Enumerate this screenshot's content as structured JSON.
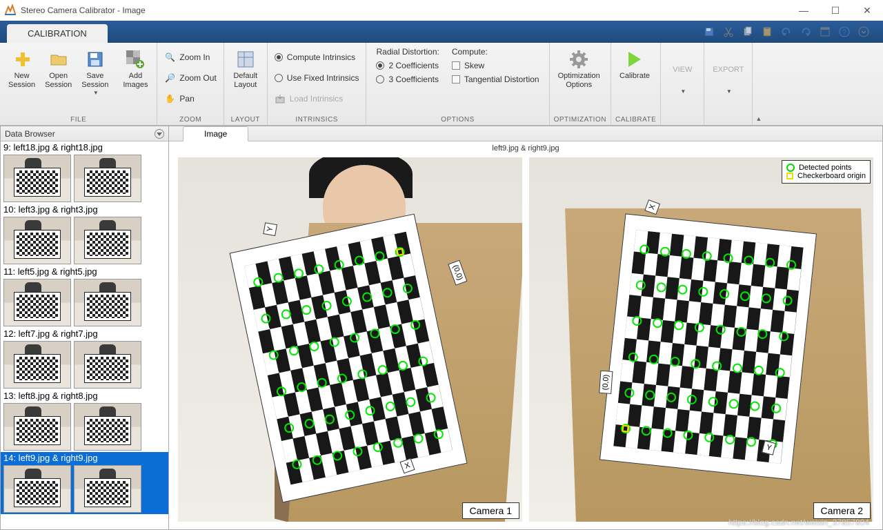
{
  "window": {
    "title": "Stereo Camera Calibrator - Image"
  },
  "main_tab": "CALIBRATION",
  "ribbon": {
    "file": {
      "new_session": "New\nSession",
      "open_session": "Open\nSession",
      "save_session": "Save\nSession",
      "add_images": "Add\nImages",
      "label": "FILE"
    },
    "zoom": {
      "in": "Zoom In",
      "out": "Zoom Out",
      "pan": "Pan",
      "label": "ZOOM"
    },
    "layout": {
      "default": "Default\nLayout",
      "label": "LAYOUT"
    },
    "intrinsics": {
      "compute": "Compute Intrinsics",
      "fixed": "Use Fixed Intrinsics",
      "load": "Load Intrinsics",
      "label": "INTRINSICS"
    },
    "options": {
      "radial_label": "Radial Distortion:",
      "r2": "2 Coefficients",
      "r3": "3 Coefficients",
      "compute_label": "Compute:",
      "skew": "Skew",
      "tangential": "Tangential Distortion",
      "label": "OPTIONS"
    },
    "optimization": {
      "btn": "Optimization\nOptions",
      "label": "OPTIMIZATION"
    },
    "calibrate": {
      "btn": "Calibrate",
      "label": "CALIBRATE"
    },
    "view": "VIEW",
    "export": "EXPORT"
  },
  "browser": {
    "title": "Data Browser",
    "items": [
      {
        "label": "9: left18.jpg & right18.jpg"
      },
      {
        "label": "10: left3.jpg & right3.jpg"
      },
      {
        "label": "11: left5.jpg & right5.jpg"
      },
      {
        "label": "12: left7.jpg & right7.jpg"
      },
      {
        "label": "13: left8.jpg & right8.jpg"
      },
      {
        "label": "14: left9.jpg & right9.jpg"
      }
    ],
    "selected_index": 5
  },
  "viewer": {
    "tab": "Image",
    "pair_title": "left9.jpg & right9.jpg",
    "cam1_label": "Camera 1",
    "cam2_label": "Camera 2",
    "origin_label": "(0,0)",
    "axis_x": "X",
    "axis_y": "Y",
    "legend": {
      "detected": "Detected points",
      "origin": "Checkerboard origin"
    }
  },
  "watermark": "https://blog.csdn.net/weixin_37857804"
}
